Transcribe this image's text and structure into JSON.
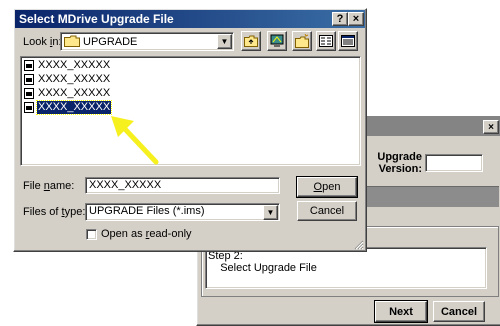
{
  "wizard": {
    "close_glyph": "×",
    "upgrade_version_label": "Upgrade\nVersion:",
    "upgrade_version_value": "",
    "step_text": "Step 2:\n    Select Upgrade File",
    "next_label": "Next",
    "cancel_label": "Cancel"
  },
  "dialog": {
    "title": "Select MDrive Upgrade File",
    "help_glyph": "?",
    "close_glyph": "×",
    "look_in_label": "Look in:",
    "look_in_value": "UPGRADE",
    "files": [
      {
        "name": "XXXX_XXXXX",
        "selected": false
      },
      {
        "name": "XXXX_XXXXX",
        "selected": false
      },
      {
        "name": "XXXX_XXXXX",
        "selected": false
      },
      {
        "name": "XXXX_XXXXX",
        "selected": true
      }
    ],
    "file_name_label": "File name:",
    "file_name_value": "XXXX_XXXXX",
    "files_of_type_label": "Files of type:",
    "files_of_type_value": "UPGRADE Files (*.ims)",
    "open_label": "Open",
    "cancel_label": "Cancel",
    "open_read_only_label": "Open as read-only",
    "open_read_only_checked": false,
    "toolbar_icons": [
      "up-folder-icon",
      "desktop-icon",
      "new-folder-icon",
      "list-view-icon",
      "details-view-icon"
    ]
  },
  "annotation": {
    "arrow_color": "#f5f01e"
  },
  "colors": {
    "title_active": "#0a246a",
    "title_inactive": "#848484",
    "face": "#d4d0c8"
  }
}
